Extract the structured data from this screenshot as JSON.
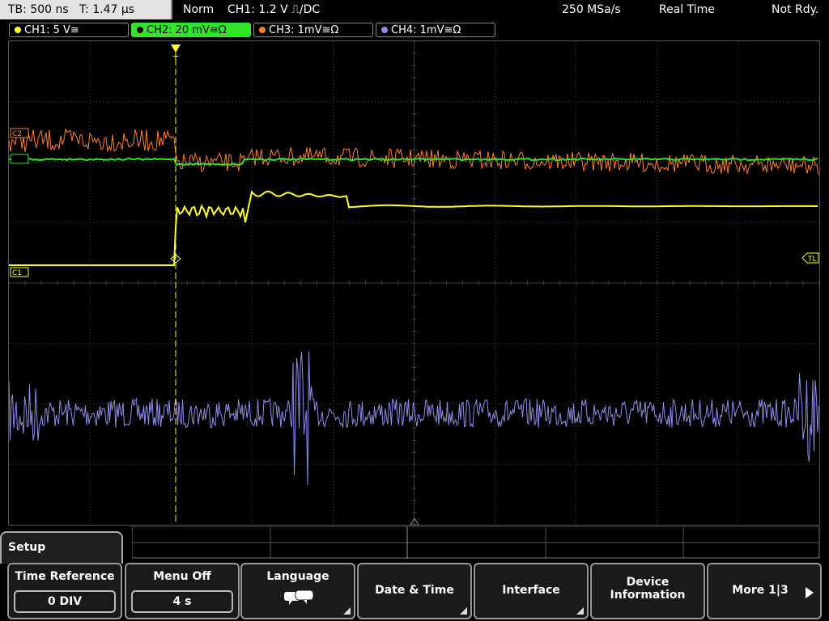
{
  "status": {
    "timebase": "TB: 500 ns",
    "trigger_time": "T: 1.47 µs",
    "mode": "Norm",
    "trigger_info": "CH1: 1.2 V ⎍/DC",
    "sample_rate": "250 MSa/s",
    "acq_mode": "Real Time",
    "state": "Not Rdy."
  },
  "channels": [
    {
      "id": "CH1",
      "label": "CH1: 5 V≅",
      "color": "#ffff33",
      "active": false
    },
    {
      "id": "CH2",
      "label": "CH2: 20 mV≅Ω",
      "color": "#36e22b",
      "active": true
    },
    {
      "id": "CH3",
      "label": "CH3: 1mV≅Ω",
      "color": "#ff7f27",
      "active": false
    },
    {
      "id": "CH4",
      "label": "CH4: 1mV≅Ω",
      "color": "#8e8ee8",
      "active": false
    }
  ],
  "markers": {
    "c2": "C2",
    "c1": "C1",
    "tl": "TL",
    "trigger": "T"
  },
  "menu": {
    "title": "Setup",
    "softkeys": [
      {
        "label": "Time Reference",
        "value": "0 DIV"
      },
      {
        "label": "Menu Off",
        "value": "4 s"
      },
      {
        "label": "Language",
        "icon": "speech-bubble-icon"
      },
      {
        "label": "Date & Time"
      },
      {
        "label": "Interface"
      },
      {
        "label": "Device Information"
      },
      {
        "label": "More 1|3",
        "icon": "arrow-right-icon"
      }
    ]
  },
  "colors": {
    "ch1": "#ffff33",
    "ch2": "#36e22b",
    "ch3": "#ff7f27",
    "ch4": "#8e8ee8",
    "grid": "#3a3a3a"
  }
}
